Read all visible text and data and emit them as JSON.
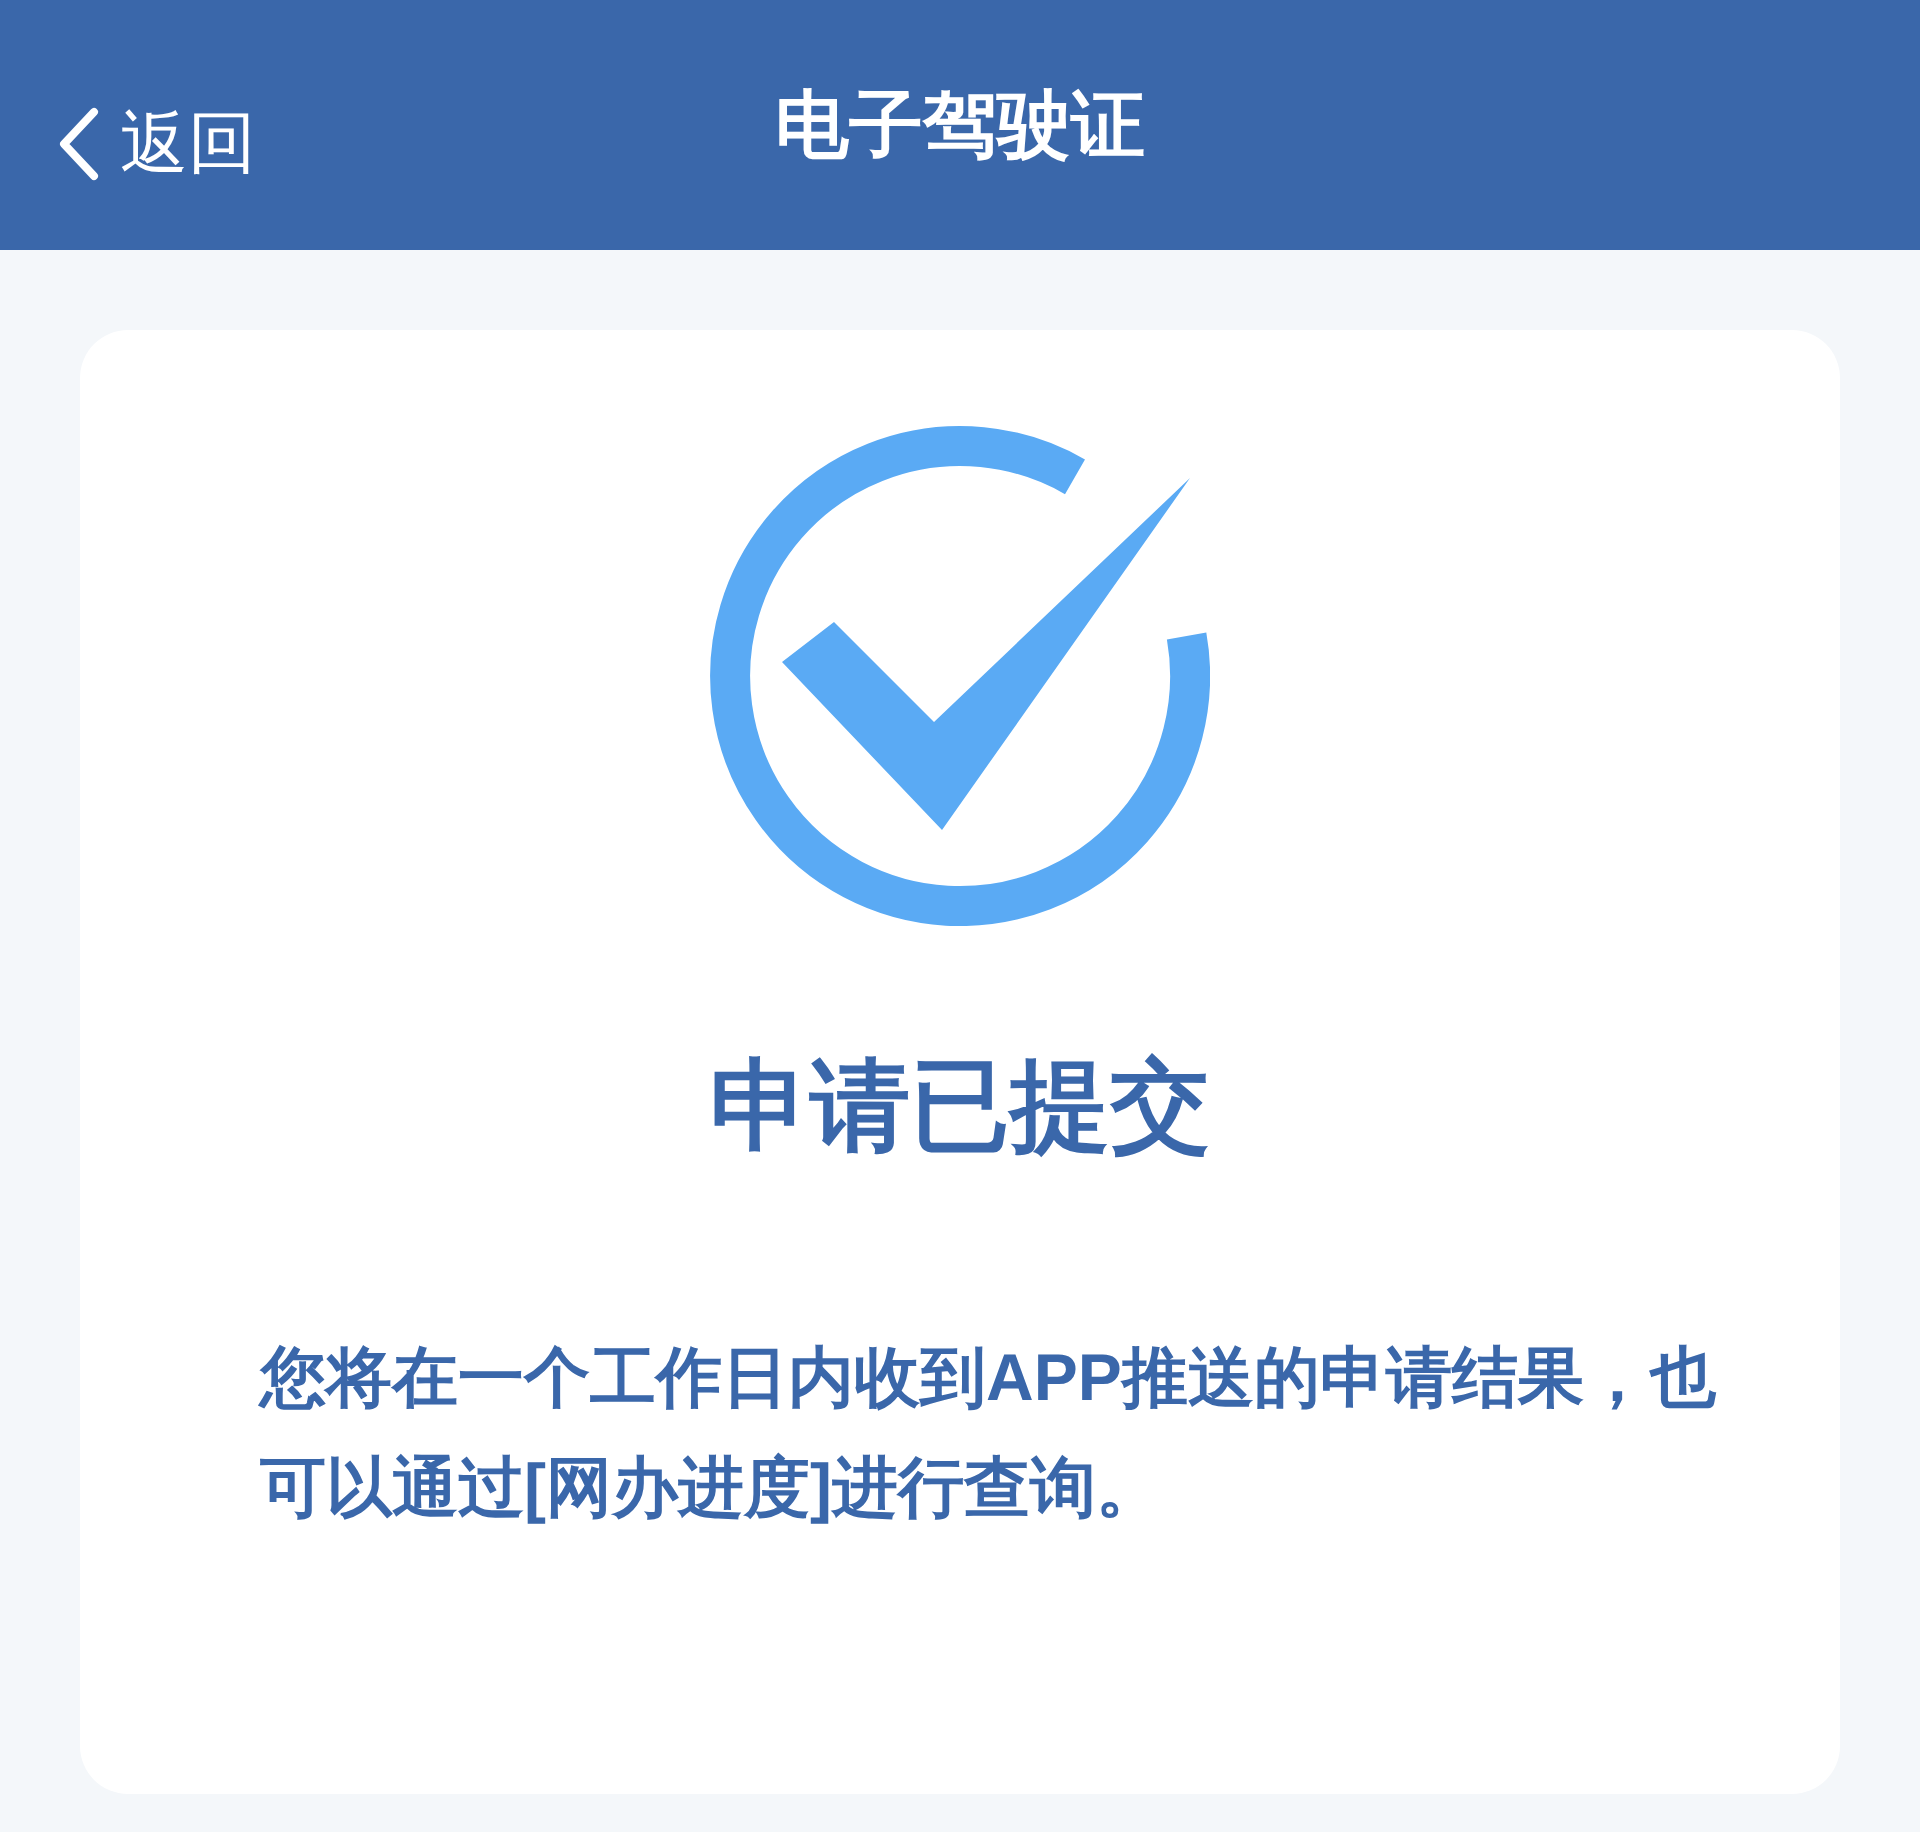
{
  "header": {
    "back": "返回",
    "title": "电子驾驶证"
  },
  "result": {
    "heading": "申请已提交",
    "message": "您将在一个工作日内收到APP推送的申请结果，也可以通过[网办进度]进行查询。"
  }
}
